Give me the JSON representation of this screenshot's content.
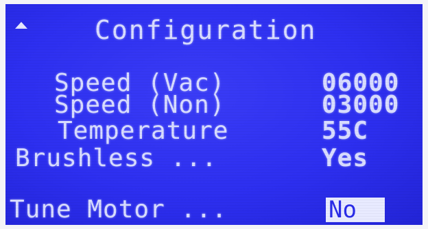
{
  "screen": {
    "title": "Configuration",
    "rows": [
      {
        "label": "Speed (Vac)",
        "value": "06000"
      },
      {
        "label": "Speed (Non)",
        "value": "03000"
      },
      {
        "label": "Temperature",
        "value": "55C"
      },
      {
        "label": "Brushless ...",
        "value": "Yes"
      }
    ],
    "action": {
      "label": "Tune Motor ...",
      "value": "No"
    }
  },
  "icons": {
    "scroll_up": "up-arrow-icon"
  },
  "colors": {
    "background": "#2d2ff0",
    "text": "#d8dcff",
    "highlight_bg": "#e8eaff",
    "highlight_text": "#2a2ce8"
  }
}
